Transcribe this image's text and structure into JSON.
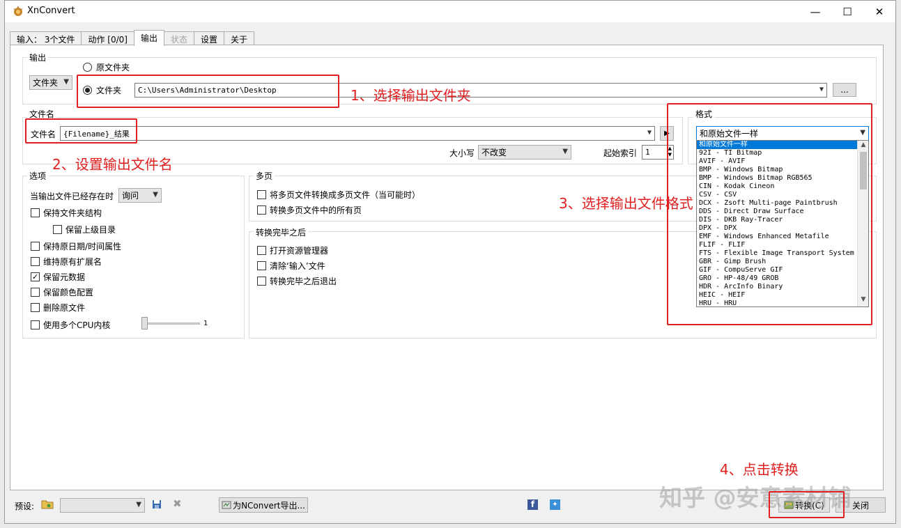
{
  "window": {
    "title": "XnConvert",
    "min": "—",
    "max": "☐",
    "close": "✕"
  },
  "tabs": [
    {
      "label": "输入： 3个文件"
    },
    {
      "label": "动作 [0/0]"
    },
    {
      "label": "输出"
    },
    {
      "label": "状态"
    },
    {
      "label": "设置"
    },
    {
      "label": "关于"
    }
  ],
  "output_group": {
    "title": "输出",
    "mode_combo": "文件夹",
    "radio_original": "原文件夹",
    "radio_folder": "文件夹",
    "path": "C:\\Users\\Administrator\\Desktop",
    "browse": "..."
  },
  "filename_group": {
    "title": "文件名",
    "label": "文件名",
    "value": "{Filename}_结果",
    "case_label": "大小写",
    "case_value": "不改变",
    "start_index_label": "起始索引",
    "start_index_value": "1"
  },
  "format_group": {
    "title": "格式",
    "selected": "和原始文件一样",
    "items": [
      "和原始文件一样",
      "92I - TI Bitmap",
      "AVIF - AVIF",
      "BMP - Windows Bitmap",
      "BMP - Windows Bitmap RGB565",
      "CIN - Kodak Cineon",
      "CSV - CSV",
      "DCX - Zsoft Multi-page Paintbrush",
      "DDS - Direct Draw Surface",
      "DIS - DKB Ray-Tracer",
      "DPX - DPX",
      "EMF - Windows Enhanced Metafile",
      "FLIF - FLIF",
      "FTS - Flexible Image Transport System",
      "GBR - Gimp Brush",
      "GIF - CompuServe GIF",
      "GRO - HP-48/49 GROB",
      "HDR - ArcInfo Binary",
      "HEIC - HEIF",
      "HRU - HRU"
    ]
  },
  "options_group": {
    "title": "选项",
    "exists_label": "当输出文件已经存在时",
    "exists_value": "询问",
    "keep_structure": "保持文件夹结构",
    "keep_parent": "保留上级目录",
    "keep_date": "保持原日期/时间属性",
    "keep_ext": "维持原有扩展名",
    "keep_meta": "保留元数据",
    "keep_color": "保留颜色配置",
    "delete_orig": "删除原文件",
    "multi_cpu": "使用多个CPU内核",
    "cpu_value": "1"
  },
  "multipage_group": {
    "title": "多页",
    "convert_multi": "将多页文件转换成多页文件（当可能时）",
    "convert_all": "转换多页文件中的所有页"
  },
  "after_group": {
    "title": "转换完毕之后",
    "open_explorer": "打开资源管理器",
    "clear_input": "清除‘输入’文件",
    "exit_after": "转换完毕之后退出"
  },
  "footer": {
    "preset_label": "预设:",
    "export_button": "为NConvert导出...",
    "convert_button": "转换(C)",
    "close_button": "关闭"
  },
  "annotations": {
    "step1": "1、选择输出文件夹",
    "step2": "2、设置输出文件名",
    "step3": "3、选择输出文件格式",
    "step4": "4、点击转换"
  },
  "watermark": "知乎 @安意素材铺",
  "colors": {
    "annotation": "#e02020",
    "selection": "#0078d7"
  }
}
